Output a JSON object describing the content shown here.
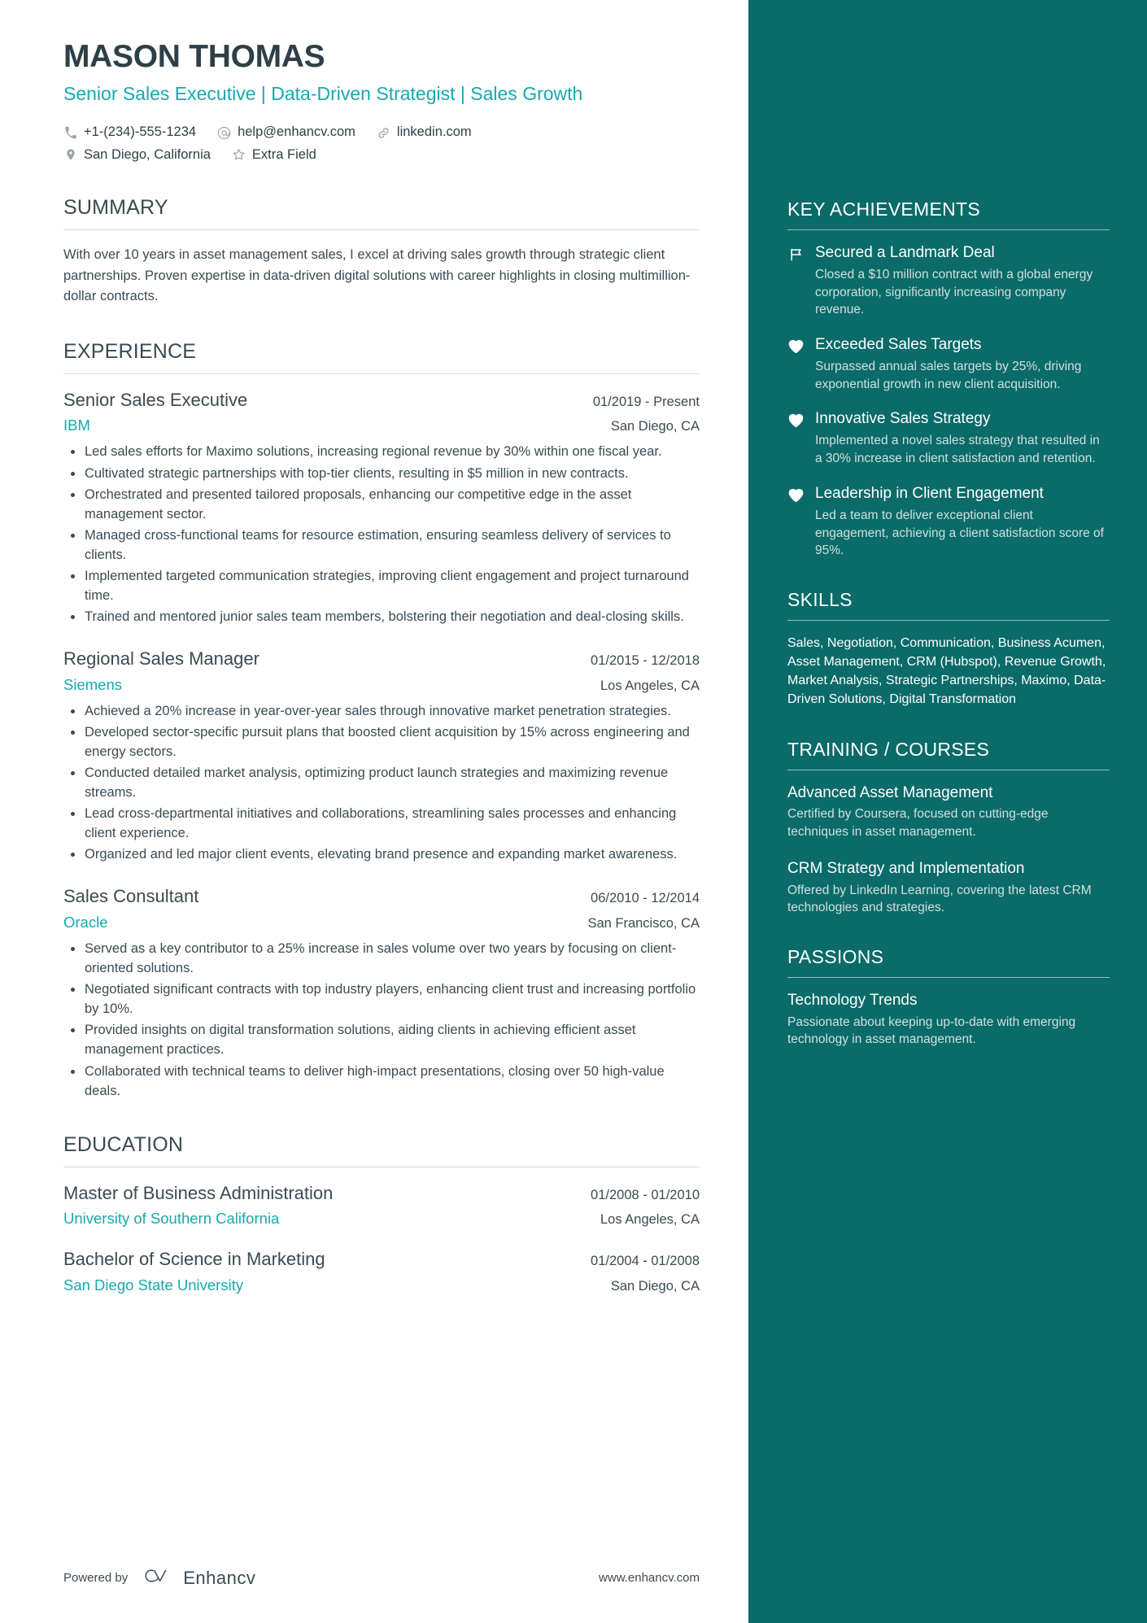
{
  "colors": {
    "accent_teal": "#18a8ae",
    "sidebar_bg": "#0a6b69",
    "text_dark": "#3b4a52",
    "name_dark": "#2e3f47",
    "sidebar_muted": "#cfe0df"
  },
  "header": {
    "name": "MASON THOMAS",
    "headline": "Senior Sales Executive | Data-Driven Strategist | Sales Growth",
    "contacts_row1": [
      {
        "icon": "phone-icon",
        "text": "+1-(234)-555-1234"
      },
      {
        "icon": "email-icon",
        "text": "help@enhancv.com"
      },
      {
        "icon": "link-icon",
        "text": "linkedin.com"
      }
    ],
    "contacts_row2": [
      {
        "icon": "location-pin-icon",
        "text": "San Diego, California"
      },
      {
        "icon": "star-icon",
        "text": "Extra Field"
      }
    ]
  },
  "summary": {
    "title": "SUMMARY",
    "text": "With over 10 years in asset management sales, I excel at driving sales growth through strategic client partnerships. Proven expertise in data-driven digital solutions with career highlights in closing multimillion-dollar contracts."
  },
  "experience": {
    "title": "EXPERIENCE",
    "entries": [
      {
        "position": "Senior Sales Executive",
        "date": "01/2019 - Present",
        "company": "IBM",
        "location": "San Diego, CA",
        "bullets": [
          "Led sales efforts for Maximo solutions, increasing regional revenue by 30% within one fiscal year.",
          "Cultivated strategic partnerships with top-tier clients, resulting in $5 million in new contracts.",
          "Orchestrated and presented tailored proposals, enhancing our competitive edge in the asset management sector.",
          "Managed cross-functional teams for resource estimation, ensuring seamless delivery of services to clients.",
          "Implemented targeted communication strategies, improving client engagement and project turnaround time.",
          "Trained and mentored junior sales team members, bolstering their negotiation and deal-closing skills."
        ]
      },
      {
        "position": "Regional Sales Manager",
        "date": "01/2015 - 12/2018",
        "company": "Siemens",
        "location": "Los Angeles, CA",
        "bullets": [
          "Achieved a 20% increase in year-over-year sales through innovative market penetration strategies.",
          "Developed sector-specific pursuit plans that boosted client acquisition by 15% across engineering and energy sectors.",
          "Conducted detailed market analysis, optimizing product launch strategies and maximizing revenue streams.",
          "Lead cross-departmental initiatives and collaborations, streamlining sales processes and enhancing client experience.",
          "Organized and led major client events, elevating brand presence and expanding market awareness."
        ]
      },
      {
        "position": "Sales Consultant",
        "date": "06/2010 - 12/2014",
        "company": "Oracle",
        "location": "San Francisco, CA",
        "bullets": [
          "Served as a key contributor to a 25% increase in sales volume over two years by focusing on client-oriented solutions.",
          "Negotiated significant contracts with top industry players, enhancing client trust and increasing portfolio by 10%.",
          "Provided insights on digital transformation solutions, aiding clients in achieving efficient asset management practices.",
          "Collaborated with technical teams to deliver high-impact presentations, closing over 50 high-value deals."
        ]
      }
    ]
  },
  "education": {
    "title": "EDUCATION",
    "entries": [
      {
        "degree": "Master of Business Administration",
        "date": "01/2008 - 01/2010",
        "school": "University of Southern California",
        "location": "Los Angeles, CA"
      },
      {
        "degree": "Bachelor of Science in Marketing",
        "date": "01/2004 - 01/2008",
        "school": "San Diego State University",
        "location": "San Diego, CA"
      }
    ]
  },
  "footer": {
    "powered_by": "Powered by",
    "brand": "Enhancv",
    "website": "www.enhancv.com"
  },
  "sidebar": {
    "achievements": {
      "title": "KEY ACHIEVEMENTS",
      "items": [
        {
          "icon": "flag-icon",
          "title": "Secured a Landmark Deal",
          "desc": "Closed a $10 million contract with a global energy corporation, significantly increasing company revenue."
        },
        {
          "icon": "heart-icon",
          "title": "Exceeded Sales Targets",
          "desc": "Surpassed annual sales targets by 25%, driving exponential growth in new client acquisition."
        },
        {
          "icon": "heart-icon",
          "title": "Innovative Sales Strategy",
          "desc": "Implemented a novel sales strategy that resulted in a 30% increase in client satisfaction and retention."
        },
        {
          "icon": "heart-icon",
          "title": "Leadership in Client Engagement",
          "desc": "Led a team to deliver exceptional client engagement, achieving a client satisfaction score of 95%."
        }
      ]
    },
    "skills": {
      "title": "SKILLS",
      "text": "Sales, Negotiation, Communication, Business Acumen, Asset Management, CRM (Hubspot), Revenue Growth, Market Analysis, Strategic Partnerships, Maximo, Data-Driven Solutions, Digital Transformation"
    },
    "training": {
      "title": "TRAINING / COURSES",
      "items": [
        {
          "title": "Advanced Asset Management",
          "desc": "Certified by Coursera, focused on cutting-edge techniques in asset management."
        },
        {
          "title": "CRM Strategy and Implementation",
          "desc": "Offered by LinkedIn Learning, covering the latest CRM technologies and strategies."
        }
      ]
    },
    "passions": {
      "title": "PASSIONS",
      "items": [
        {
          "title": "Technology Trends",
          "desc": "Passionate about keeping up-to-date with emerging technology in asset management."
        }
      ]
    }
  }
}
